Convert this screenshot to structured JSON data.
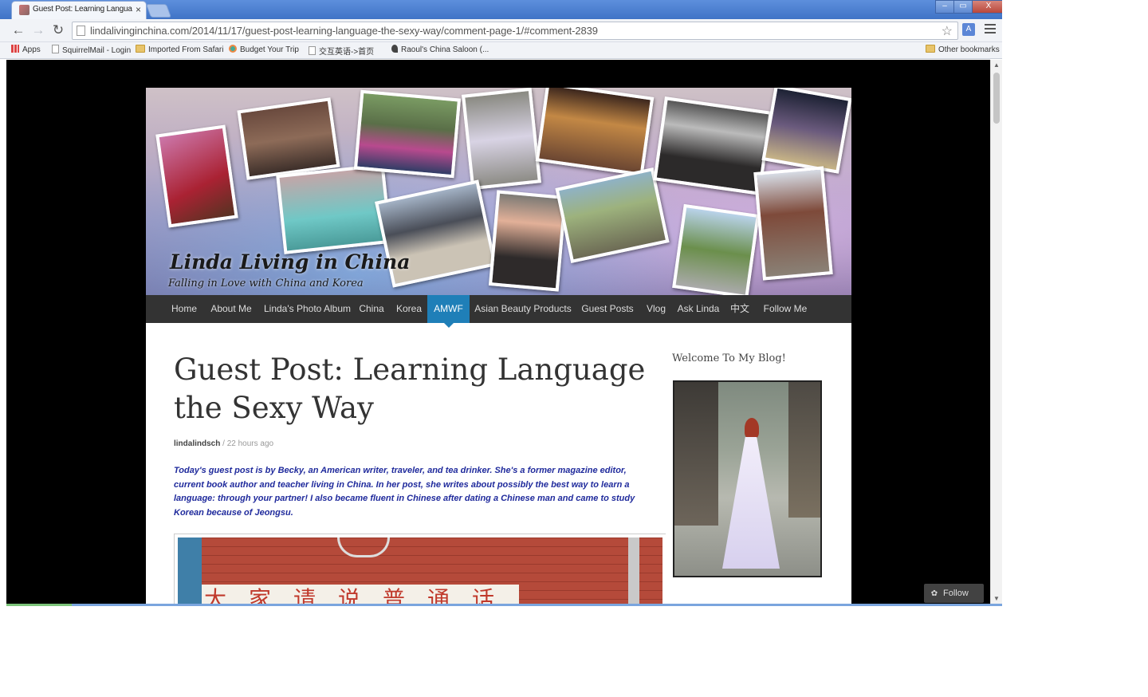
{
  "browser": {
    "tab_title": "Guest Post: Learning Langua",
    "tab_close": "×",
    "url": "lindalivinginchina.com/2014/11/17/guest-post-learning-language-the-sexy-way/comment-page-1/#comment-2839",
    "window_buttons": {
      "minimize": "–",
      "maximize": "▭",
      "close": "X"
    },
    "icons": {
      "back": "back-arrow-icon",
      "forward": "forward-arrow-icon",
      "reload": "reload-icon",
      "star": "star-icon",
      "menu": "hamburger-menu-icon"
    }
  },
  "bookmarks": {
    "items": [
      {
        "label": "Apps",
        "icon": "apps"
      },
      {
        "label": "SquirrelMail - Login",
        "icon": "page"
      },
      {
        "label": "Imported From Safari",
        "icon": "folder"
      },
      {
        "label": "Budget Your Trip",
        "icon": "globe"
      },
      {
        "label": "交互英语->首页",
        "icon": "page"
      },
      {
        "label": "Raoul's China Saloon (...",
        "icon": "pin"
      }
    ],
    "other": "Other bookmarks"
  },
  "site": {
    "title": "Linda Living in China",
    "tagline": "Falling in Love with China and Korea",
    "nav": [
      {
        "label": "Home",
        "active": false
      },
      {
        "label": "About Me",
        "active": false
      },
      {
        "label": "Linda's Photo Album",
        "active": false
      },
      {
        "label": "China",
        "active": false
      },
      {
        "label": "Korea",
        "active": false
      },
      {
        "label": "AMWF",
        "active": true
      },
      {
        "label": "Asian Beauty Products",
        "active": false
      },
      {
        "label": "Guest Posts",
        "active": false
      },
      {
        "label": "Vlog",
        "active": false
      },
      {
        "label": "Ask Linda",
        "active": false
      },
      {
        "label": "中文",
        "active": false
      },
      {
        "label": "Follow Me",
        "active": false
      }
    ],
    "accent_color": "#1f7fb8"
  },
  "post": {
    "title": "Guest Post: Learning Language the Sexy Way",
    "author": "lindalindsch",
    "separator": " / ",
    "time": "22 hours ago",
    "intro": "Today's guest post is by Becky, an American writer, traveler, and tea drinker. She's a former magazine editor, current book author and teacher living in China. In her post, she writes about possibly the best way to learn a language: through your partner! I also became fluent in Chinese after dating a Chinese man and came to study Korean because of Jeongsu.",
    "image_text": "大家请说普通话"
  },
  "sidebar": {
    "title": "Welcome To My Blog!"
  },
  "follow": {
    "label": "Follow",
    "icon": "wordpress-follow-icon"
  }
}
